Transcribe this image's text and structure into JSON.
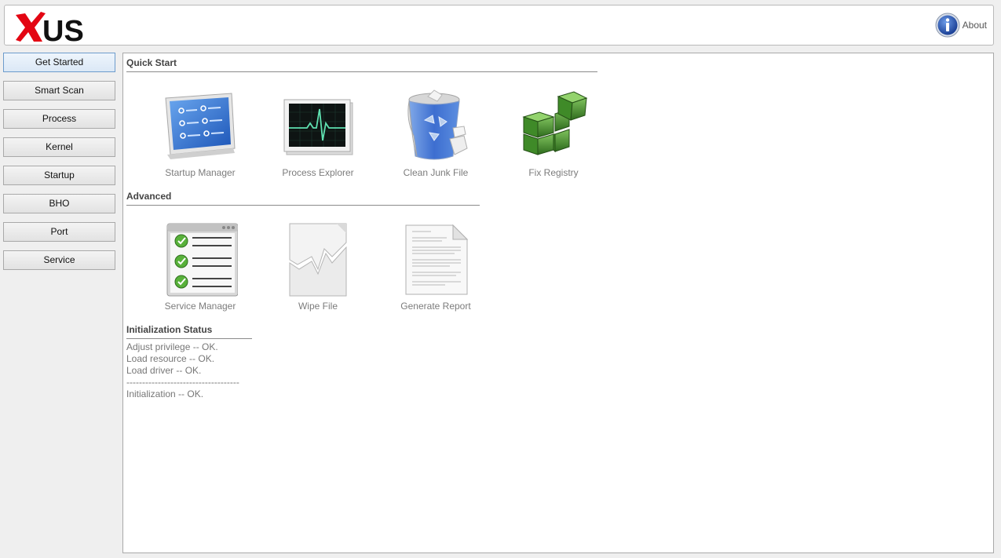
{
  "app": {
    "logo_text": "US"
  },
  "header": {
    "about_label": "About"
  },
  "sidebar": {
    "items": [
      {
        "label": "Get Started",
        "active": true
      },
      {
        "label": "Smart Scan"
      },
      {
        "label": "Process"
      },
      {
        "label": "Kernel"
      },
      {
        "label": "Startup"
      },
      {
        "label": "BHO"
      },
      {
        "label": "Port"
      },
      {
        "label": "Service"
      }
    ]
  },
  "quick_start": {
    "title": "Quick Start",
    "tiles": [
      {
        "label": "Startup Manager",
        "icon": "startup-manager-icon"
      },
      {
        "label": "Process Explorer",
        "icon": "process-explorer-icon"
      },
      {
        "label": "Clean Junk File",
        "icon": "recycle-bin-icon"
      },
      {
        "label": "Fix Registry",
        "icon": "registry-cubes-icon"
      }
    ]
  },
  "advanced": {
    "title": "Advanced",
    "tiles": [
      {
        "label": "Service Manager",
        "icon": "service-list-icon"
      },
      {
        "label": "Wipe File",
        "icon": "shredded-file-icon"
      },
      {
        "label": "Generate Report",
        "icon": "report-document-icon"
      }
    ]
  },
  "init_status": {
    "title": "Initialization Status",
    "lines": [
      "Adjust privilege -- OK.",
      "Load resource -- OK.",
      "Load driver -- OK.",
      "------------------------------------",
      "Initialization -- OK."
    ]
  },
  "colors": {
    "logo_red": "#e30613",
    "active_border": "#6d9ccc",
    "about_blue": "#1f4fa8"
  }
}
